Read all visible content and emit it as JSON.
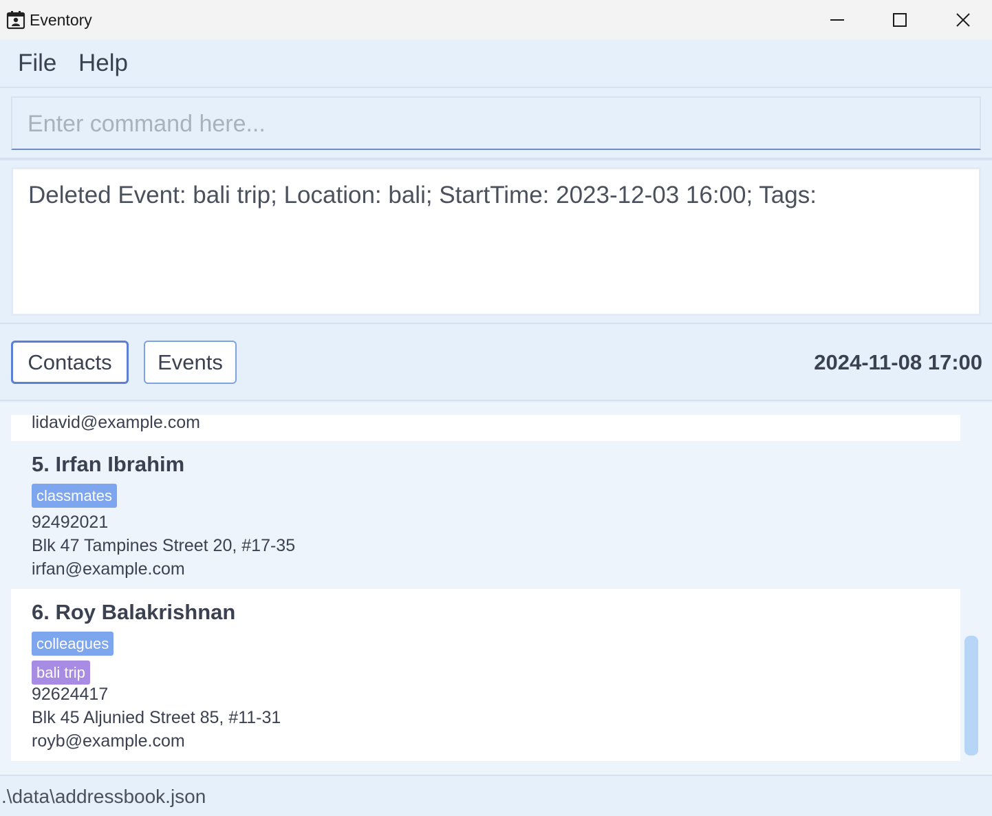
{
  "window": {
    "title": "Eventory",
    "icons": {
      "app": "calendar-contact-icon",
      "minimize": "minimize-icon",
      "maximize": "maximize-icon",
      "close": "close-icon"
    }
  },
  "menu": {
    "file_label": "File",
    "help_label": "Help"
  },
  "command": {
    "placeholder": "Enter command here...",
    "value": ""
  },
  "result": {
    "text": "Deleted Event: bali trip; Location: bali; StartTime: 2023-12-03 16:00; Tags:"
  },
  "tabs": {
    "contacts_label": "Contacts",
    "events_label": "Events",
    "active": "Contacts"
  },
  "datetime": "2024-11-08 17:00",
  "contacts": {
    "partial": {
      "email": "lidavid@example.com"
    },
    "items": [
      {
        "name": "5. Irfan Ibrahim",
        "tags": [
          {
            "label": "classmates",
            "color": "#7ea6ef"
          }
        ],
        "phone": "92492021",
        "address": "Blk 47 Tampines Street 20, #17-35",
        "email": "irfan@example.com"
      },
      {
        "name": "6. Roy Balakrishnan",
        "tags": [
          {
            "label": "colleagues",
            "color": "#7ea6ef"
          },
          {
            "label": "bali trip",
            "color": "#a88be3"
          }
        ],
        "phone": "92624417",
        "address": "Blk 45 Aljunied Street 85, #11-31",
        "email": "royb@example.com"
      }
    ]
  },
  "status": {
    "file_path": ".\\data\\addressbook.json"
  },
  "colors": {
    "accent": "#5b7fd6",
    "background": "#e6f0fb",
    "tag_blue": "#7ea6ef",
    "tag_purple": "#a88be3"
  }
}
